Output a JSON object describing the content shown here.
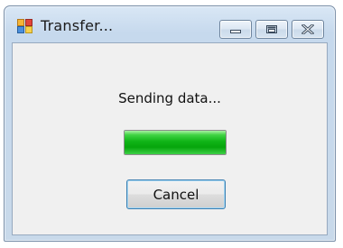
{
  "window": {
    "title": "Transfer...",
    "app_icon": "application-icon",
    "caption_buttons": [
      "minimize-icon",
      "maximize-icon",
      "close-icon"
    ]
  },
  "dialog": {
    "status_text": "Sending data...",
    "progress_fraction": 1.0,
    "progress_color": "#10b417",
    "cancel_label": "Cancel"
  }
}
